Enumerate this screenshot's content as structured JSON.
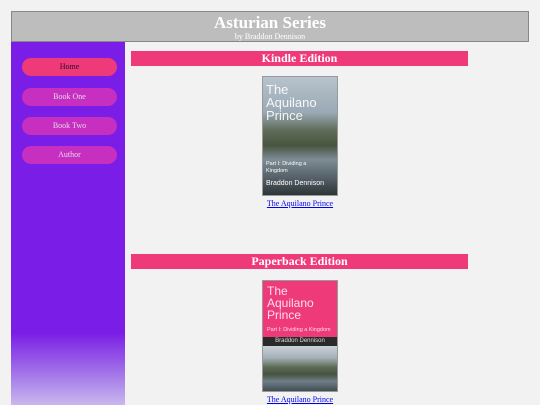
{
  "header": {
    "title": "Asturian Series",
    "subtitle": "by Braddon Dennison"
  },
  "sidebar": {
    "items": [
      {
        "label": "Home",
        "active": true
      },
      {
        "label": "Book One",
        "active": false
      },
      {
        "label": "Book Two",
        "active": false
      },
      {
        "label": "Author",
        "active": false
      }
    ]
  },
  "kindle": {
    "heading": "Kindle Edition",
    "cover": {
      "title_line1": "The",
      "title_line2": "Aquilano",
      "title_line3": "Prince",
      "subtitle_line1": "Part I: Dividing a",
      "subtitle_line2": "Kingdom",
      "author": "Braddon Dennison"
    },
    "link": "The Aquilano Prince"
  },
  "paperback": {
    "heading": "Paperback Edition",
    "cover": {
      "title_line1": "The",
      "title_line2": "Aquilano",
      "title_line3": "Prince",
      "subtitle": "Part I: Dividing a Kingdom",
      "author": "Braddon Dennison"
    },
    "link": "The Aquilano Prince"
  },
  "colors": {
    "sidebar": "#7a1de6",
    "accent": "#ee3a78",
    "nav_button": "#c62fbf",
    "header": "#bdbdbd"
  }
}
